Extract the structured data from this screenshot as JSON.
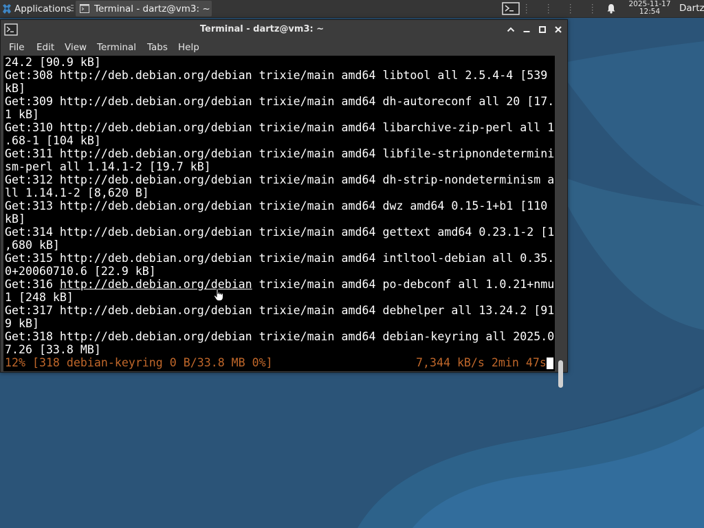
{
  "panel": {
    "applications_label": "Applications",
    "task_label": "Terminal - dartz@vm3: ~",
    "clock_date": "2025-11-17",
    "clock_time": "12:54",
    "user_label": "Dartz"
  },
  "window": {
    "title": "Terminal - dartz@vm3: ~",
    "menu": [
      "File",
      "Edit",
      "View",
      "Terminal",
      "Tabs",
      "Help"
    ]
  },
  "terminal": {
    "lines": [
      "24.2 [90.9 kB]",
      "Get:308 http://deb.debian.org/debian trixie/main amd64 libtool all 2.5.4-4 [539",
      "kB]",
      "Get:309 http://deb.debian.org/debian trixie/main amd64 dh-autoreconf all 20 [17.",
      "1 kB]",
      "Get:310 http://deb.debian.org/debian trixie/main amd64 libarchive-zip-perl all 1",
      ".68-1 [104 kB]",
      "Get:311 http://deb.debian.org/debian trixie/main amd64 libfile-stripnondetermini",
      "sm-perl all 1.14.1-2 [19.7 kB]",
      "Get:312 http://deb.debian.org/debian trixie/main amd64 dh-strip-nondeterminism a",
      "ll 1.14.1-2 [8,620 B]",
      "Get:313 http://deb.debian.org/debian trixie/main amd64 dwz amd64 0.15-1+b1 [110",
      "kB]",
      "Get:314 http://deb.debian.org/debian trixie/main amd64 gettext amd64 0.23.1-2 [1",
      ",680 kB]",
      "Get:315 http://deb.debian.org/debian trixie/main amd64 intltool-debian all 0.35.",
      "0+20060710.6 [22.9 kB]",
      "Get:316 http://deb.debian.org/debian trixie/main amd64 po-debconf all 1.0.21+nmu",
      "1 [248 kB]",
      "Get:317 http://deb.debian.org/debian trixie/main amd64 debhelper all 13.24.2 [91",
      "9 kB]",
      "Get:318 http://deb.debian.org/debian trixie/main amd64 debian-keyring all 2025.0",
      "7.26 [33.8 MB]"
    ],
    "hover_line": {
      "prefix": "Get:316 ",
      "link": "http://deb.debian.org/debian",
      "suffix": " trixie/main amd64 po-debconf all 1.0.21+nmu"
    },
    "status_left": "12% [318 debian-keyring 0 B/33.8 MB 0%]",
    "status_right": "7,344 kB/s 2min 47s"
  },
  "colors": {
    "status_text": "#c0672a",
    "terminal_bg": "#000000",
    "window_chrome": "#3c3c3c",
    "panel_bg": "#363636"
  },
  "icons": {
    "apps": "xfce-mouse-icon",
    "task": "terminal-icon",
    "window": "terminal-icon",
    "tray": "terminal-icon",
    "notifications": "bell-icon",
    "controls": [
      "chevron-up-icon",
      "minimize-icon",
      "maximize-icon",
      "close-icon"
    ]
  }
}
